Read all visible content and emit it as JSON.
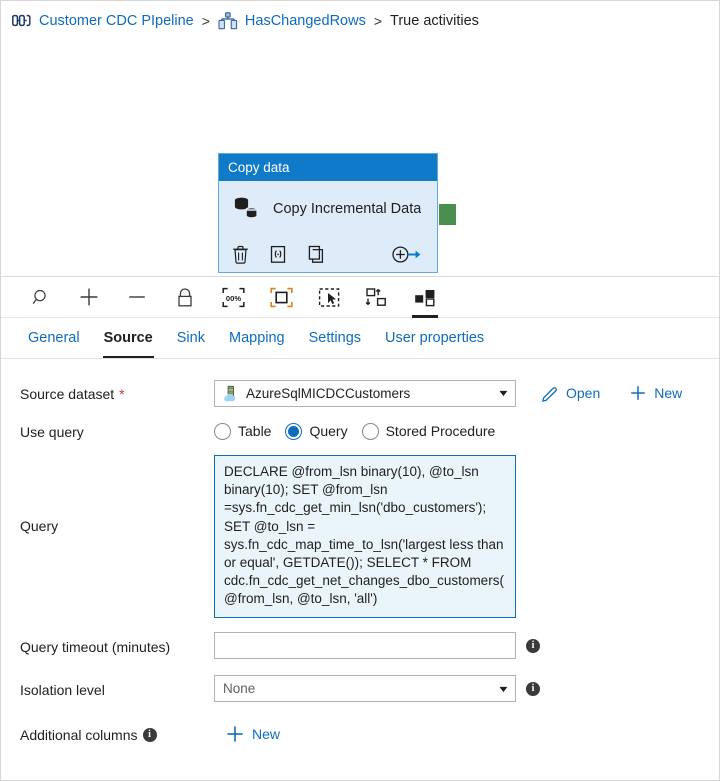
{
  "breadcrumb": {
    "pipeline_icon": "pipeline-icon",
    "pipeline_name": "Customer CDC PIpeline",
    "separator_1": ">",
    "condition_icon": "if-condition-icon",
    "condition_name": "HasChangedRows",
    "separator_2": ">",
    "current": "True activities"
  },
  "canvas": {
    "node": {
      "header_label": "Copy data",
      "activity_icon": "copy-data-icon",
      "title": "Copy Incremental Data",
      "tools": [
        {
          "name": "delete-activity-icon",
          "label": "Delete"
        },
        {
          "name": "code-view-icon",
          "label": "Code"
        },
        {
          "name": "clone-activity-icon",
          "label": "Clone"
        },
        {
          "name": "add-output-icon",
          "label": "Add output"
        }
      ],
      "output_handle": "output-connector-handle"
    },
    "toolbar": [
      {
        "name": "zoom-search-icon",
        "label": "Zoom"
      },
      {
        "name": "zoom-in-icon",
        "label": "Zoom in"
      },
      {
        "name": "zoom-out-icon",
        "label": "Zoom out"
      },
      {
        "name": "lock-canvas-icon",
        "label": "Lock canvas"
      },
      {
        "name": "zoom-to-100-icon",
        "label": "100%"
      },
      {
        "name": "zoom-to-fit-icon",
        "label": "Zoom to fit"
      },
      {
        "name": "select-mode-icon",
        "label": "Select"
      },
      {
        "name": "auto-align-icon",
        "label": "Auto align"
      },
      {
        "name": "toggle-panel-icon",
        "label": "Toggle panel"
      }
    ]
  },
  "tabs": [
    {
      "label": "General",
      "active": false
    },
    {
      "label": "Source",
      "active": true
    },
    {
      "label": "Sink",
      "active": false
    },
    {
      "label": "Mapping",
      "active": false
    },
    {
      "label": "Settings",
      "active": false
    },
    {
      "label": "User properties",
      "active": false
    }
  ],
  "form": {
    "source_dataset": {
      "label": "Source dataset",
      "required_marker": "*",
      "dataset_icon": "azure-sql-mi-dataset-icon",
      "value": "AzureSqlMICDCCustomers",
      "caret": "▼",
      "open_label": "Open",
      "open_icon": "pencil-icon",
      "new_label": "New",
      "new_icon": "plus-icon"
    },
    "use_query": {
      "label": "Use query",
      "options": [
        {
          "label": "Table",
          "selected": false
        },
        {
          "label": "Query",
          "selected": true
        },
        {
          "label": "Stored Procedure",
          "selected": false
        }
      ]
    },
    "query": {
      "label": "Query",
      "value": "DECLARE @from_lsn binary(10), @to_lsn binary(10); SET @from_lsn =sys.fn_cdc_get_min_lsn('dbo_customers'); SET @to_lsn = sys.fn_cdc_map_time_to_lsn('largest less than or equal', GETDATE()); SELECT * FROM cdc.fn_cdc_get_net_changes_dbo_customers(@from_lsn, @to_lsn, 'all')"
    },
    "query_timeout": {
      "label": "Query timeout (minutes)",
      "value": "",
      "info_icon": "info-icon"
    },
    "isolation_level": {
      "label": "Isolation level",
      "value": "None",
      "caret": "▼",
      "info_icon": "info-icon"
    },
    "additional_columns": {
      "label": "Additional columns",
      "info_icon": "info-icon",
      "new_label": "New",
      "new_icon": "plus-icon"
    }
  },
  "colors": {
    "link": "#0f6cbd",
    "node_header": "#0f7ac8",
    "node_body": "#deecf9",
    "node_border": "#6ba7d4",
    "handle_green": "#4a8f4f",
    "query_fill": "#eaf4fb",
    "required_red": "#d13438"
  }
}
